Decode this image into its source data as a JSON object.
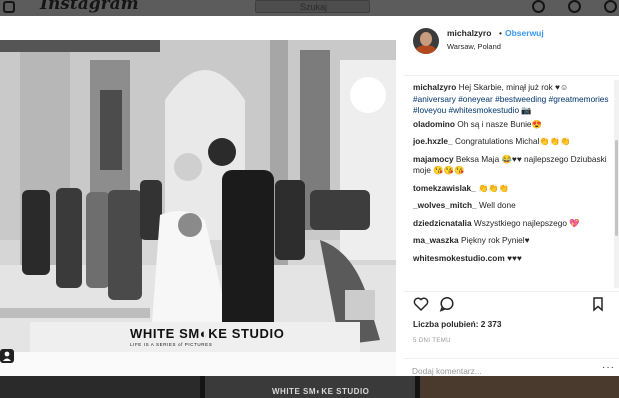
{
  "app": {
    "logo": "Instagram",
    "search_placeholder": "Szukaj"
  },
  "post": {
    "username": "michalzyro",
    "separator": "•",
    "follow_label": "Obserwuj",
    "location": "Warsaw, Poland",
    "caption": {
      "author": "michalzyro",
      "text": "Hej Skarbie, minął już rok ♥☺",
      "hashtags": "#aniversary #oneyear #bestweeding #greatmemories #loveyou #whitesmokestudio",
      "camera_glyph": "📷"
    },
    "comments": [
      {
        "user": "oladomino",
        "text": "Oh są i nasze Bunie😍"
      },
      {
        "user": "joe.hxzle_",
        "text": "Congratulations Michal👏👏👏"
      },
      {
        "user": "majamocy",
        "text": "Beksa Maja 😂♥♥ najlepszego Dziubaski moje 😘😘😘"
      },
      {
        "user": "tomekzawislak_",
        "text": "👏👏👏"
      },
      {
        "user": "_wolves_mitch_",
        "text": "Well done"
      },
      {
        "user": "dziedzicnatalia",
        "text": "Wszystkiego najlepszego 💖"
      },
      {
        "user": "ma_waszka",
        "text": "Piękny rok Pyniel♥"
      },
      {
        "user": "whitesmokestudio.com",
        "text": "♥♥♥"
      }
    ],
    "likes_label": "Liczba polubień:",
    "likes_count": "2 373",
    "date": "5 DNI TEMU",
    "comment_placeholder": "Dodaj komentarz...",
    "more_glyph": "···",
    "watermark": {
      "brand": "WHITE SM◐KE STUDIO",
      "tagline": "LIFE IS A SERIES of PICTURES"
    }
  },
  "background": {
    "watermark": "WHITE SM◐KE STUDIO"
  },
  "colors": {
    "link": "#3897f0",
    "hashtag": "#003569",
    "text": "#262626",
    "muted": "#999999"
  },
  "icons": [
    "instagram-camera-icon",
    "heart-icon",
    "comment-icon",
    "bookmark-icon",
    "tagged-person-icon"
  ]
}
